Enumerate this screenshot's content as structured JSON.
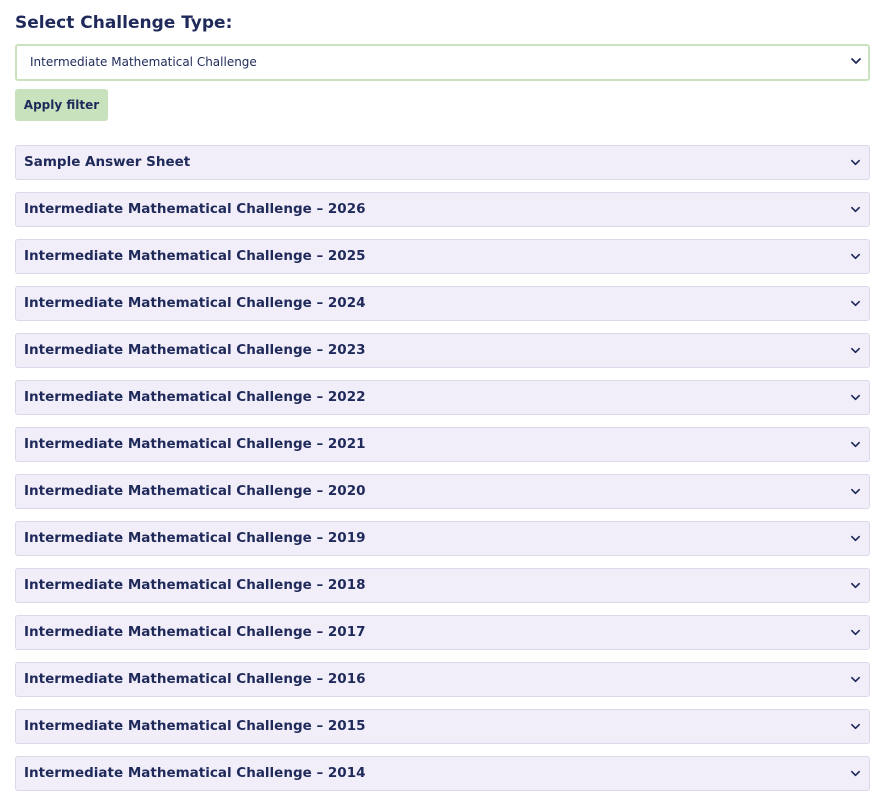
{
  "filter": {
    "title": "Select Challenge Type:",
    "selected": "Intermediate Mathematical Challenge",
    "apply_label": "Apply filter"
  },
  "accordion": {
    "items": [
      {
        "label": "Sample Answer Sheet"
      },
      {
        "label": "Intermediate Mathematical Challenge – 2026"
      },
      {
        "label": "Intermediate Mathematical Challenge – 2025"
      },
      {
        "label": "Intermediate Mathematical Challenge – 2024"
      },
      {
        "label": "Intermediate Mathematical Challenge – 2023"
      },
      {
        "label": "Intermediate Mathematical Challenge – 2022"
      },
      {
        "label": "Intermediate Mathematical Challenge – 2021"
      },
      {
        "label": "Intermediate Mathematical Challenge – 2020"
      },
      {
        "label": "Intermediate Mathematical Challenge – 2019"
      },
      {
        "label": "Intermediate Mathematical Challenge – 2018"
      },
      {
        "label": "Intermediate Mathematical Challenge – 2017"
      },
      {
        "label": "Intermediate Mathematical Challenge – 2016"
      },
      {
        "label": "Intermediate Mathematical Challenge – 2015"
      },
      {
        "label": "Intermediate Mathematical Challenge – 2014"
      }
    ]
  },
  "icons": {
    "select": "chevron-down-icon",
    "accordion": "chevron-down-icon"
  },
  "colors": {
    "text": "#1f2a5a",
    "select_border": "#c9e3bf",
    "button_bg": "#c7e2bd",
    "accordion_bg": "#f1eef9",
    "accordion_border": "#dcd7ea"
  }
}
